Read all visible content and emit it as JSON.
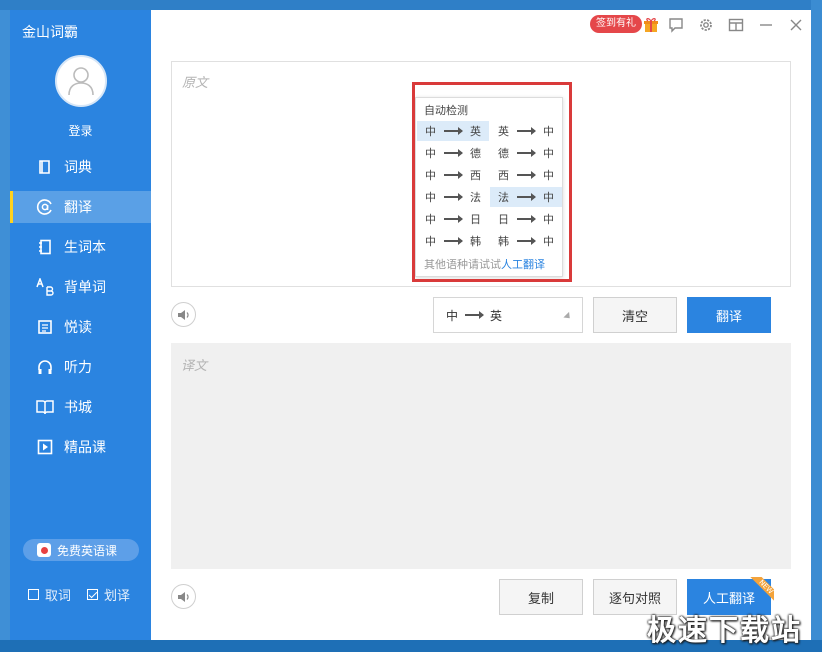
{
  "app": {
    "title": "金山词霸"
  },
  "user": {
    "login_label": "登录"
  },
  "sidebar": {
    "items": [
      {
        "label": "词典",
        "icon": "book-icon"
      },
      {
        "label": "翻译",
        "icon": "translate-icon",
        "active": true
      },
      {
        "label": "生词本",
        "icon": "notebook-icon"
      },
      {
        "label": "背单词",
        "icon": "vocab-icon"
      },
      {
        "label": "悦读",
        "icon": "reading-icon"
      },
      {
        "label": "听力",
        "icon": "headphones-icon"
      },
      {
        "label": "书城",
        "icon": "open-book-icon"
      },
      {
        "label": "精品课",
        "icon": "play-icon"
      }
    ],
    "promo": "免费英语课",
    "options": [
      {
        "label": "取词",
        "checked": false
      },
      {
        "label": "划译",
        "checked": true
      }
    ]
  },
  "titlebar": {
    "sign_badge": "签到有礼",
    "icons": [
      "gift-icon",
      "feedback-icon",
      "settings-icon",
      "mini-mode-icon",
      "minimize-icon",
      "close-icon"
    ]
  },
  "source": {
    "placeholder": "原文"
  },
  "target": {
    "placeholder": "译文"
  },
  "language": {
    "selected_from": "中",
    "selected_to": "英",
    "dropdown": {
      "header": "自动检测",
      "pairs": [
        {
          "from": "中",
          "to": "英"
        },
        {
          "from": "英",
          "to": "中"
        },
        {
          "from": "中",
          "to": "德"
        },
        {
          "from": "德",
          "to": "中"
        },
        {
          "from": "中",
          "to": "西"
        },
        {
          "from": "西",
          "to": "中"
        },
        {
          "from": "中",
          "to": "法"
        },
        {
          "from": "法",
          "to": "中"
        },
        {
          "from": "中",
          "to": "日"
        },
        {
          "from": "日",
          "to": "中"
        },
        {
          "from": "中",
          "to": "韩"
        },
        {
          "from": "韩",
          "to": "中"
        }
      ],
      "footer_text": "其他语种请试试",
      "footer_link": "人工翻译"
    }
  },
  "buttons": {
    "clear": "清空",
    "translate": "翻译",
    "copy": "复制",
    "sentence_compare": "逐句对照",
    "human_translate": "人工翻译",
    "new_tag": "NEW"
  },
  "watermark": "极速下载站",
  "colors": {
    "accent": "#2b84e0",
    "highlight": "#dcebf9",
    "alert": "#d93a3a",
    "badge": "#e5474a"
  }
}
